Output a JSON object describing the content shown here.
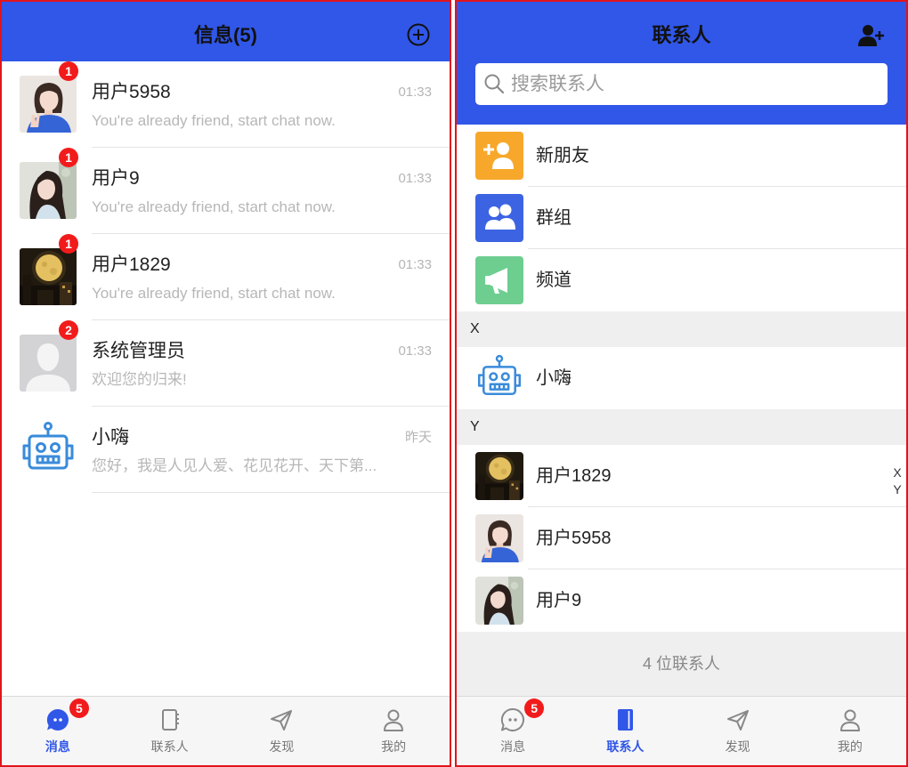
{
  "colors": {
    "primary": "#3157e8",
    "badge": "#f21b1b",
    "new_friend": "#f7a82b",
    "group": "#3c63e2",
    "channel": "#6dce90",
    "robot": "#3a8bda"
  },
  "messages_screen": {
    "header": {
      "title": "信息(5)",
      "action_icon": "plus-circle-icon"
    },
    "conversations": [
      {
        "name": "用户5958",
        "time": "01:33",
        "preview": "You're already friend, start chat now.",
        "unread": "1"
      },
      {
        "name": "用户9",
        "time": "01:33",
        "preview": "You're already friend, start chat now.",
        "unread": "1"
      },
      {
        "name": "用户1829",
        "time": "01:33",
        "preview": "You're already friend, start chat now.",
        "unread": "1"
      },
      {
        "name": "系统管理员",
        "time": "01:33",
        "preview": "欢迎您的归来!",
        "unread": "2",
        "avatar_icon": "default-avatar-icon"
      },
      {
        "name": "小嗨",
        "time": "昨天",
        "preview": "您好，我是人见人爱、花见花开、天下第...",
        "avatar_icon": "robot-icon"
      }
    ],
    "tabbar": [
      {
        "label": "消息",
        "icon": "chat-bubble-icon",
        "active": true,
        "badge": "5"
      },
      {
        "label": "联系人",
        "icon": "contacts-book-icon",
        "active": false
      },
      {
        "label": "发现",
        "icon": "paper-plane-icon",
        "active": false
      },
      {
        "label": "我的",
        "icon": "person-icon",
        "active": false
      }
    ]
  },
  "contacts_screen": {
    "header": {
      "title": "联系人",
      "action_icon": "add-user-icon"
    },
    "search": {
      "placeholder": "搜索联系人",
      "icon": "search-icon"
    },
    "shortcuts": [
      {
        "label": "新朋友",
        "icon": "new-friend-icon"
      },
      {
        "label": "群组",
        "icon": "group-icon"
      },
      {
        "label": "频道",
        "icon": "megaphone-icon"
      }
    ],
    "sections": [
      {
        "letter": "X",
        "contacts": [
          {
            "name": "小嗨",
            "avatar_icon": "robot-icon"
          }
        ]
      },
      {
        "letter": "Y",
        "contacts": [
          {
            "name": "用户1829"
          },
          {
            "name": "用户5958"
          },
          {
            "name": "用户9"
          }
        ]
      }
    ],
    "index_letters": [
      "X",
      "Y"
    ],
    "footer": "4 位联系人",
    "tabbar": [
      {
        "label": "消息",
        "icon": "chat-bubble-icon",
        "active": false,
        "badge": "5"
      },
      {
        "label": "联系人",
        "icon": "contacts-book-icon",
        "active": true
      },
      {
        "label": "发现",
        "icon": "paper-plane-icon",
        "active": false
      },
      {
        "label": "我的",
        "icon": "person-icon",
        "active": false
      }
    ]
  }
}
